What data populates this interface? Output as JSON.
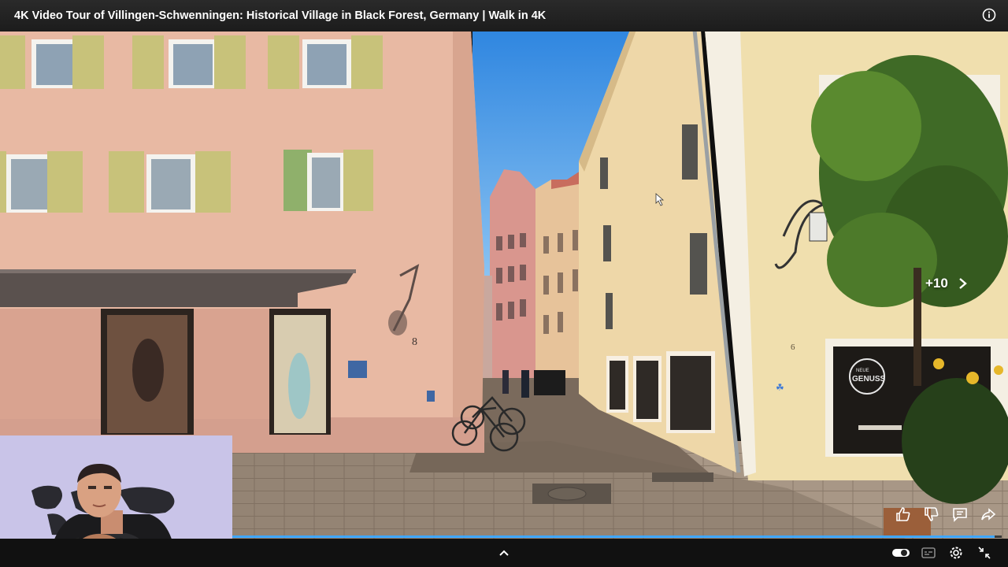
{
  "video": {
    "title": "4K Video Tour of Villingen-Schwenningen: Historical Village in Black Forest, Germany | Walk in 4K",
    "skip_label": "+10",
    "progress_fraction": 0.991,
    "scene_signs": {
      "house_number_left": "8",
      "house_number_right": "6",
      "shop_sign": "GENUSS",
      "shop_sign_small": "NEUE"
    }
  },
  "colors": {
    "accent": "#3ea6ff",
    "top_bar": "#212121",
    "bottom_bar": "#111111"
  },
  "icons": {
    "info": "info-icon",
    "skip": "chevron-right-icon",
    "like": "thumbs-up-icon",
    "dislike": "thumbs-down-icon",
    "comments": "comment-icon",
    "share": "share-icon",
    "expand": "chevron-up-icon",
    "autoplay": "toggle-icon",
    "captions": "captions-icon",
    "settings": "gear-icon",
    "exit_fullscreen": "collapse-icon"
  }
}
